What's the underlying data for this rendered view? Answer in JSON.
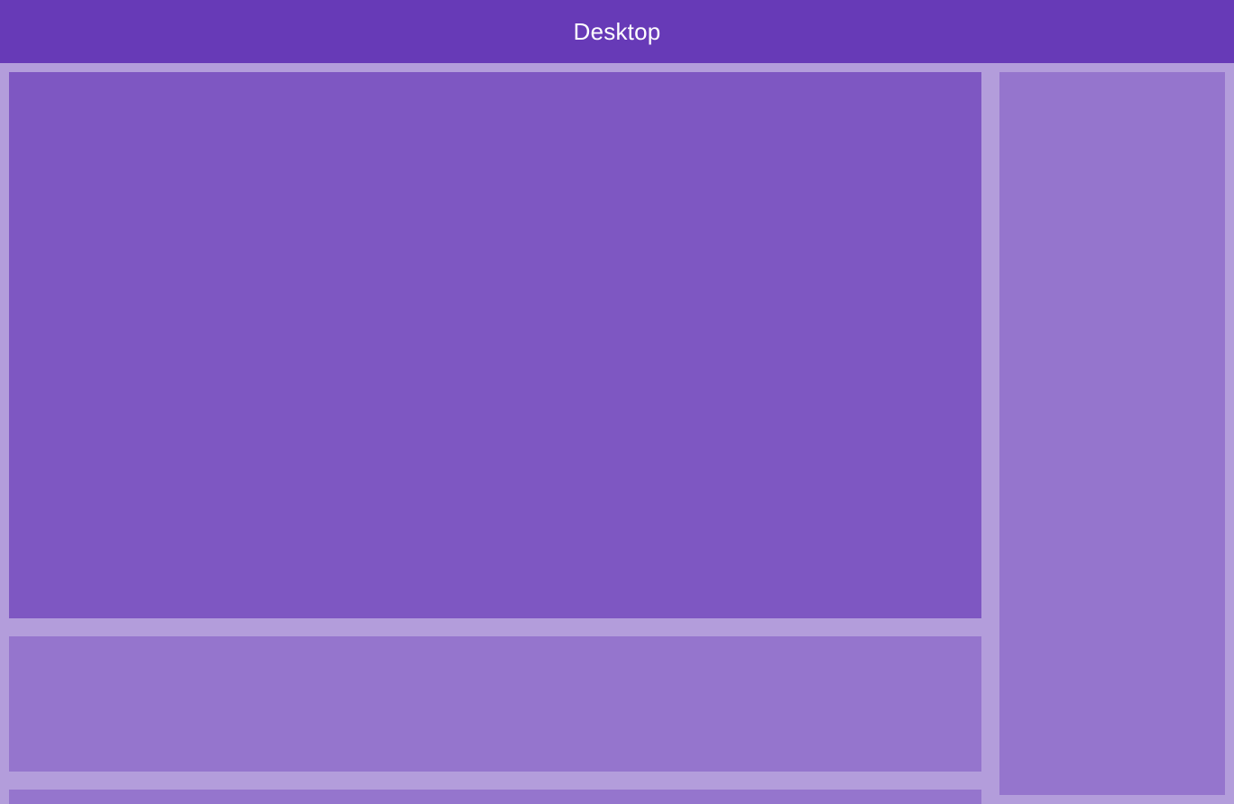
{
  "header": {
    "title": "Desktop"
  },
  "theme": {
    "header_color": "#673ab7",
    "background_color": "#b39ddb",
    "main_panel_color": "#7e57c2",
    "secondary_panel_color": "#9575cd",
    "title_text_color": "#ffffff"
  }
}
